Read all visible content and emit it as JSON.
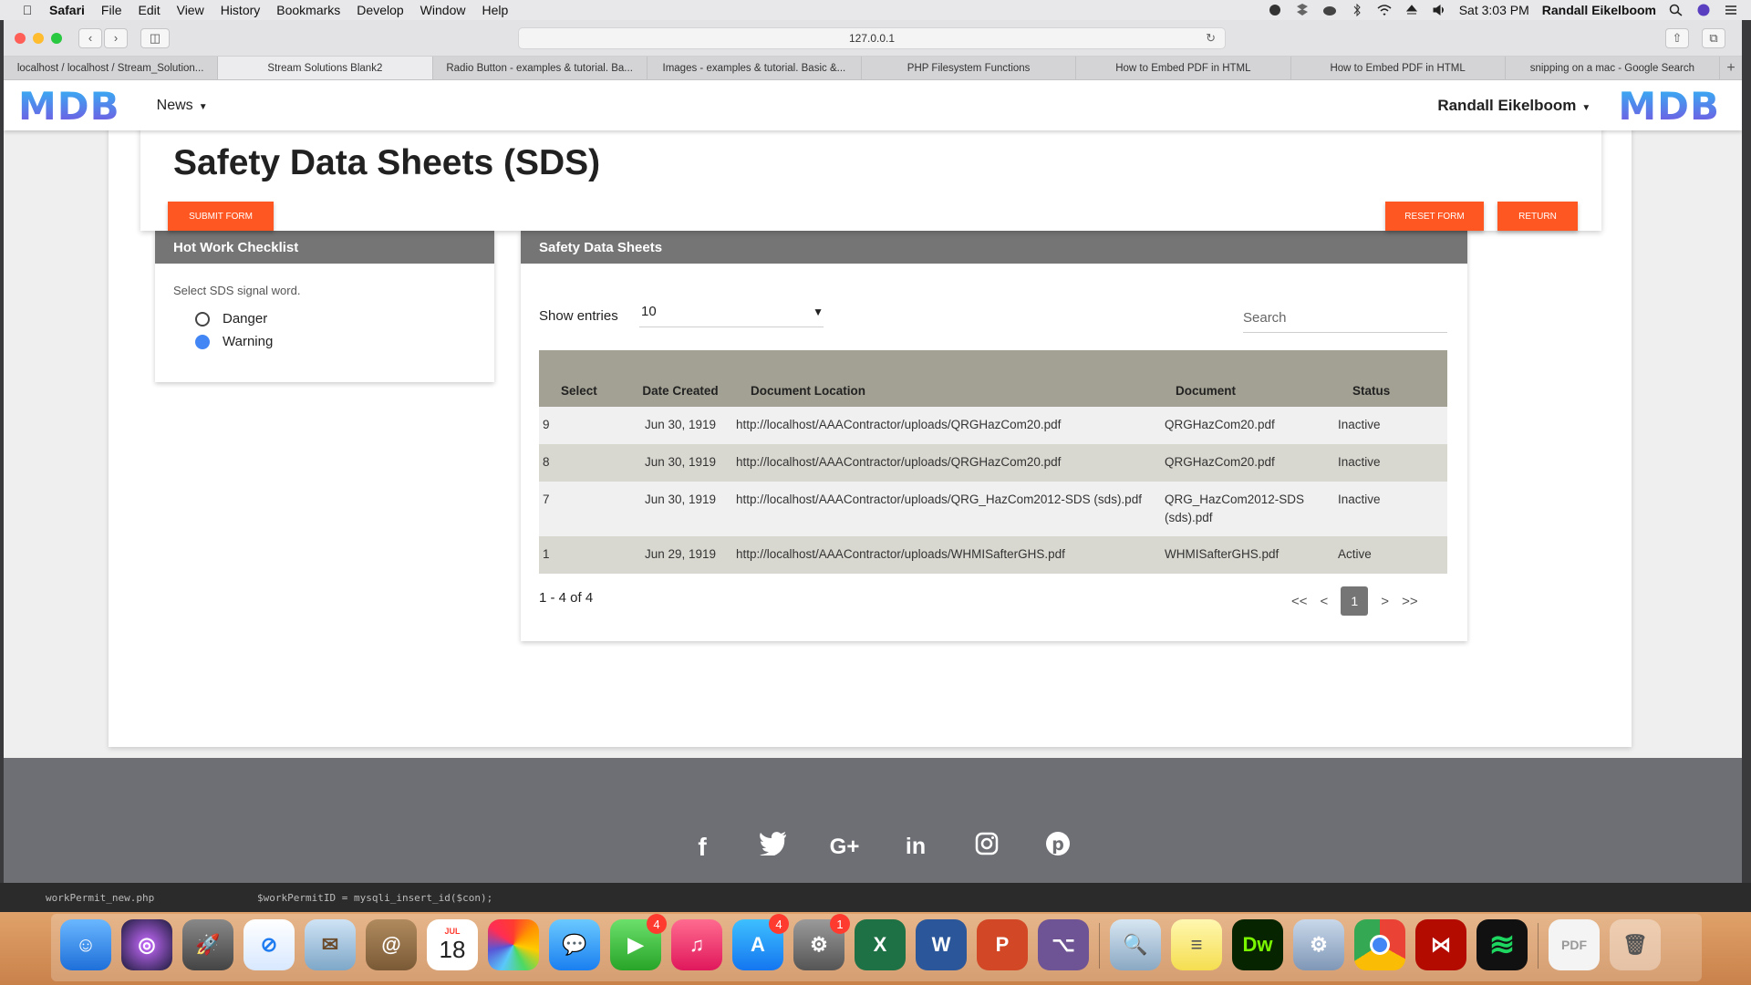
{
  "menubar": {
    "app": "Safari",
    "items": [
      "File",
      "Edit",
      "View",
      "History",
      "Bookmarks",
      "Develop",
      "Window",
      "Help"
    ],
    "clock": "Sat 3:03 PM",
    "user": "Randall Eikelboom"
  },
  "browser": {
    "url": "127.0.0.1",
    "tabs": [
      "localhost / localhost / Stream_Solution...",
      "Stream Solutions Blank2",
      "Radio Button - examples & tutorial. Ba...",
      "Images - examples & tutorial. Basic &...",
      "PHP Filesystem Functions",
      "How to Embed PDF in HTML",
      "How to Embed PDF in HTML",
      "snipping on a mac - Google Search"
    ],
    "active_tab": 1
  },
  "nav": {
    "logo": "MDB",
    "news": "News",
    "user": "Randall Eikelboom"
  },
  "header": {
    "title": "Safety Data Sheets (SDS)",
    "submit": "SUBMIT FORM",
    "reset": "RESET FORM",
    "return": "RETURN"
  },
  "hotwork": {
    "title": "Hot Work Checklist",
    "prompt": "Select SDS signal word.",
    "options": [
      {
        "label": "Danger",
        "selected": false
      },
      {
        "label": "Warning",
        "selected": true
      }
    ]
  },
  "sds": {
    "title": "Safety Data Sheets",
    "show_entries_label": "Show entries",
    "entries_value": "10",
    "search_placeholder": "Search",
    "columns": [
      "Select",
      "Date Created",
      "Document Location",
      "Document",
      "Status"
    ],
    "rows": [
      {
        "select": "9",
        "date": "Jun 30, 1919",
        "location": "http://localhost/AAAContractor/uploads/QRGHazCom20.pdf",
        "document": "QRGHazCom20.pdf",
        "status": "Inactive"
      },
      {
        "select": "8",
        "date": "Jun 30, 1919",
        "location": "http://localhost/AAAContractor/uploads/QRGHazCom20.pdf",
        "document": "QRGHazCom20.pdf",
        "status": "Inactive"
      },
      {
        "select": "7",
        "date": "Jun 30, 1919",
        "location": "http://localhost/AAAContractor/uploads/QRG_HazCom2012-SDS (sds).pdf",
        "document": "QRG_HazCom2012-SDS (sds).pdf",
        "status": "Inactive"
      },
      {
        "select": "1",
        "date": "Jun 29, 1919",
        "location": "http://localhost/AAAContractor/uploads/WHMISafterGHS.pdf",
        "document": "WHMISafterGHS.pdf",
        "status": "Active"
      }
    ],
    "count": "1 - 4 of 4",
    "pager": {
      "first": "<<",
      "prev": "<",
      "current": "1",
      "next": ">",
      "last": ">>"
    }
  },
  "footer": {
    "social": [
      "facebook-icon",
      "twitter-icon",
      "google-plus-icon",
      "linkedin-icon",
      "instagram-icon",
      "pinterest-icon"
    ]
  },
  "editor_behind": {
    "file": "workPermit_new.php",
    "code": "$workPermitID = mysqli_insert_id($con);"
  },
  "dock": {
    "calendar_month": "JUL",
    "calendar_day": "18",
    "badges": {
      "facetime": "4",
      "appstore": "4",
      "sysprefs": "1"
    }
  },
  "colors": {
    "accent": "#ff5722",
    "panel_header": "#757575",
    "table_header": "#a3a193",
    "radio_selected": "#4285f4",
    "footer": "#6d6f75"
  }
}
